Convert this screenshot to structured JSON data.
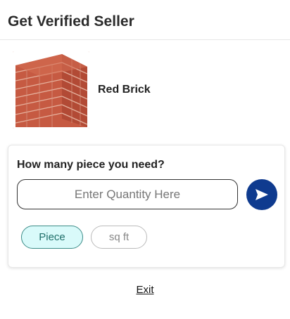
{
  "header": {
    "title": "Get Verified Seller"
  },
  "product": {
    "name": "Red Brick",
    "image_icon": "brick-stack-image"
  },
  "quantity_card": {
    "question": "How many piece you need?",
    "input_placeholder": "Enter Quantity Here",
    "input_value": "",
    "send_icon": "send-arrow-icon",
    "units": [
      {
        "label": "Piece",
        "selected": true
      },
      {
        "label": "sq ft",
        "selected": false
      }
    ]
  },
  "footer": {
    "exit_label": "Exit"
  },
  "colors": {
    "send_button": "#0f3b8f",
    "chip_selected_bg": "#d9fafa",
    "chip_selected_border": "#3c8c88"
  }
}
